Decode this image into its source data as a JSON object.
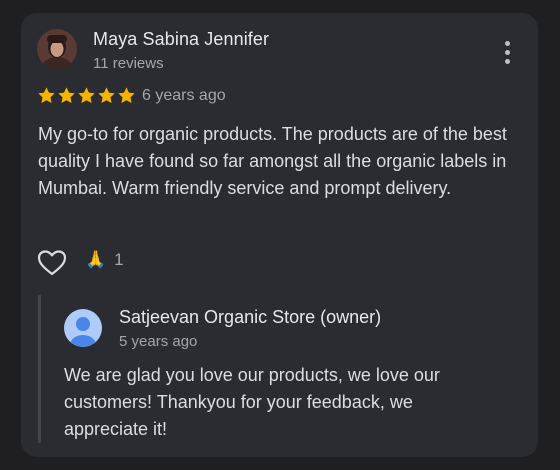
{
  "review": {
    "reviewer_name": "Maya Sabina Jennifer",
    "reviewer_meta": "11 reviews",
    "rating": 5,
    "rating_max": 5,
    "time": "6 years ago",
    "text": "My go-to for organic products. The products are of the best quality I have found so far amongst all the organic labels in Mumbai. Warm friendly service and prompt delivery.",
    "reaction_emoji": "🙏",
    "reaction_count": "1"
  },
  "owner_response": {
    "name": "Satjeevan Organic Store (owner)",
    "time": "5 years ago",
    "text": "We are glad you love our products, we love our customers! Thankyou for your feedback, we appreciate it!"
  },
  "icons": {
    "more": "more-vert-icon",
    "like": "heart-outline-icon",
    "star": "star-filled-icon",
    "reaction": "folded-hands-emoji"
  },
  "colors": {
    "background": "#1f1f22",
    "card": "#2b2c31",
    "star": "#f5b400",
    "owner_avatar": "#aecbfa",
    "owner_avatar_figure": "#4a86e8"
  }
}
